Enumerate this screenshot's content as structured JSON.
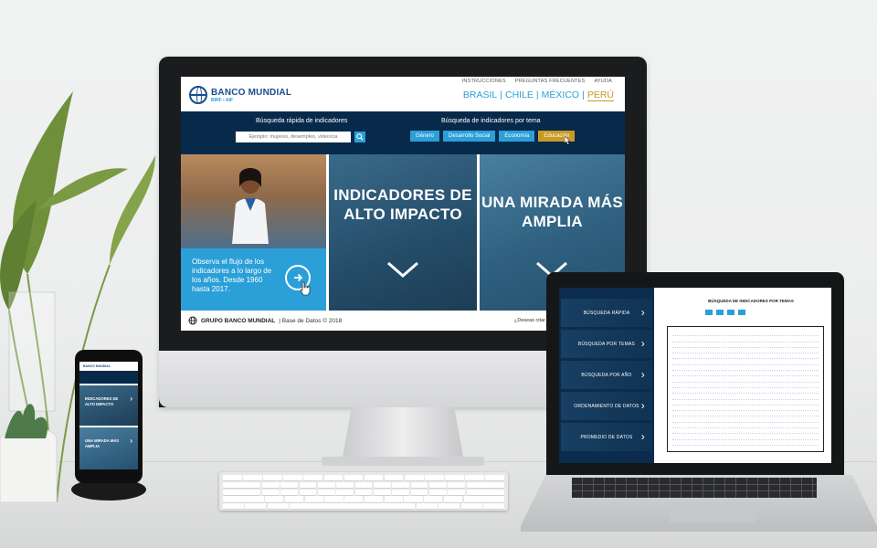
{
  "site": {
    "util_links": [
      "INSTRUCCIONES",
      "PREGUNTAS FRECUENTES",
      "AYUDA"
    ],
    "logo_title": "BANCO MUNDIAL",
    "logo_subtitle": "BIRF • AIF",
    "countries": [
      "BRASIL",
      "CHILE",
      "MÉXICO",
      "PERÚ"
    ],
    "quick_search_label": "Búsqueda rápida de indicadores",
    "quick_search_placeholder": "Ejemplo: mujeres, desempleo, violencia",
    "topic_search_label": "Búsqueda de indicadores por tema",
    "topics": [
      "Género",
      "Desarrollo Social",
      "Economía",
      "Educación"
    ],
    "flow_text": "Observa el flujo de los indicadores a lo largo de los años. Desde 1960 hasta 2017.",
    "panel2_title": "INDICADORES DE ALTO IMPACTO",
    "panel3_title": "UNA MIRADA MÁS AMPLIA",
    "footer_brand": "GRUPO BANCO MUNDIAL",
    "footer_db": "| Base de Datos © 2018",
    "footer_ask": "¿Deseas citar e"
  },
  "laptop": {
    "menu": [
      "BÚSQUEDA RÁPIDA",
      "BÚSQUEDA POR TEMAS",
      "BÚSQUEDA POR AÑO",
      "ORDENAMIENTO DE DATOS",
      "PROMEDIO DE DATOS"
    ],
    "title": "BÚSQUEDA DE INDICADORES POR TEMAS"
  },
  "phone": {
    "header": "BANCO MUNDIAL",
    "block1": "INDICADORES DE ALTO IMPACTO",
    "block2": "UNA MIRADA MÁS AMPLIA"
  },
  "colors": {
    "navy": "#072a4b",
    "accent_blue": "#2b9fd8",
    "gold": "#c89a24",
    "brand_blue": "#1b4d8a"
  }
}
